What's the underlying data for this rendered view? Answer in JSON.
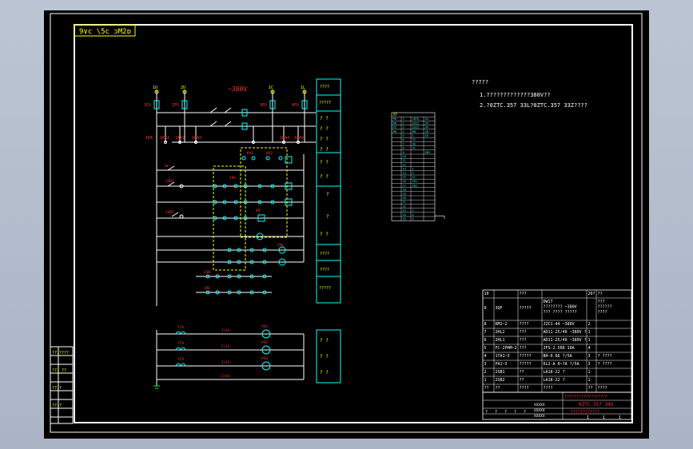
{
  "title_tab": "9∨c \\5c ɔM2ɒ",
  "voltage_label": "~380V",
  "top_terminals": [
    "1U",
    "2U",
    "1C",
    "1L"
  ],
  "fuses": [
    "1FU",
    "2FU",
    "3FU",
    "1FU",
    "4FU"
  ],
  "relay_labels": [
    "1KA",
    "1KA1",
    "1KA2",
    "1KA3",
    "1KA4",
    "1KA5"
  ],
  "button_labels": [
    "2SB1",
    "2SB2",
    "KM",
    "1KA",
    "KA1",
    "KA2"
  ],
  "legend_boxes": [
    "????",
    "?????",
    "? ?",
    "? ?",
    "? ?",
    "? ?",
    "? ?",
    "? ?",
    "?",
    "?",
    "? ?",
    "????",
    "????",
    "?????",
    "? ?",
    "? ?",
    "? ?",
    "? ?"
  ],
  "bottom_circuit": {
    "ct": [
      "1TA",
      "2TA",
      "3TA"
    ],
    "meters": [
      "PA1",
      "PA2",
      "PA3"
    ],
    "nets": [
      "1(A1)",
      "2(A1)",
      "3(A1)",
      "2(A1)"
    ]
  },
  "notes": {
    "title": "?????",
    "line1": "1.?????????????380V??",
    "line2": "2.?0ZTC.357 33L?0ZTC.357 33Z????"
  },
  "terminal_table": {
    "header": [
      "XT"
    ],
    "rows": [
      [
        "PN",
        "1",
        "10FU",
        "2U"
      ],
      [
        "PB",
        "2",
        "2U12",
        "2P"
      ],
      [
        "PC",
        "3",
        "2U22",
        "3P"
      ],
      [
        "PN",
        "4",
        "PN",
        "1N"
      ],
      [
        "",
        "5",
        "1",
        "10"
      ],
      [
        "",
        "6",
        "22",
        ""
      ],
      [
        "",
        "7",
        "20",
        ""
      ],
      [
        "",
        "8",
        "21",
        ""
      ],
      [
        "",
        "9",
        "",
        "SB1"
      ],
      [
        "",
        "10",
        "",
        ""
      ],
      [
        "",
        "11",
        "",
        ""
      ],
      [
        "",
        "12",
        "",
        ""
      ],
      [
        "",
        "13",
        "1",
        ""
      ],
      [
        "",
        "14",
        "3",
        ""
      ],
      [
        "",
        "15",
        "21",
        ""
      ],
      [
        "",
        "16",
        "201",
        ""
      ],
      [
        "",
        "17",
        "202",
        ""
      ],
      [
        "",
        "18",
        "",
        ""
      ],
      [
        "",
        "19",
        "",
        ""
      ],
      [
        "",
        "20",
        "",
        ""
      ],
      [
        "",
        "21",
        "",
        ""
      ],
      [
        "",
        "22",
        "",
        ""
      ],
      [
        "",
        "23",
        "1",
        ""
      ],
      [
        "",
        "24",
        "2",
        ""
      ],
      [
        "",
        "25",
        "3",
        ""
      ]
    ]
  },
  "bom": {
    "rows": [
      [
        "10",
        "",
        "???",
        "",
        "20?",
        "??"
      ],
      [
        "9",
        "3QF",
        "?????",
        "DW17\n???????? ~380V\n??? ???? ?????",
        "",
        "???\n??????\n????"
      ],
      [
        "8",
        "KM1~2",
        "????",
        "JZC1-44 ~380V",
        "2",
        ""
      ],
      [
        "7",
        "2HL2",
        "???",
        "AD11-25/40 ~380V ?",
        "1",
        ""
      ],
      [
        "6",
        "2HL1",
        "???",
        "AD11-25/40 ~380V ?",
        "1",
        ""
      ],
      [
        "5",
        "FC-2PHM~2",
        "???",
        "JFS-2.5RD 10A",
        "4",
        ""
      ],
      [
        "4",
        "1TA1~3",
        "?????",
        "BH-0.66 ?/5A",
        "3",
        "? ????"
      ],
      [
        "3",
        "PA1~3",
        "?????",
        "6L2-A 0~?A ?/5A",
        "3",
        "? ????"
      ],
      [
        "2",
        "2SB1",
        "??",
        "LA18-22 ?",
        "1",
        ""
      ],
      [
        "1",
        "2SB2",
        "??",
        "LA18-22 ?",
        "1",
        ""
      ],
      [
        "??",
        "??",
        "????",
        "????",
        "??",
        "????"
      ]
    ],
    "title_block": {
      "a": "??????????????????",
      "dwg": "0ZTC.357 34S",
      "cols": [
        "?",
        "?",
        "?",
        "?",
        "?"
      ],
      "names": [
        "XXXXX",
        "XXXXX",
        "XXXXX"
      ],
      "sub": "????????????",
      "scale": [
        "1",
        "1",
        "1"
      ]
    }
  },
  "left_tab": [
    "???????",
    "",
    "??? ??",
    "",
    "????",
    "",
    "????",
    "",
    ""
  ],
  "colors": {
    "line": "#ffffff",
    "cyan": "#00ffff",
    "yellow": "#ffff00",
    "red": "#ff3333",
    "green": "#00ff00",
    "bg": "#000000"
  }
}
